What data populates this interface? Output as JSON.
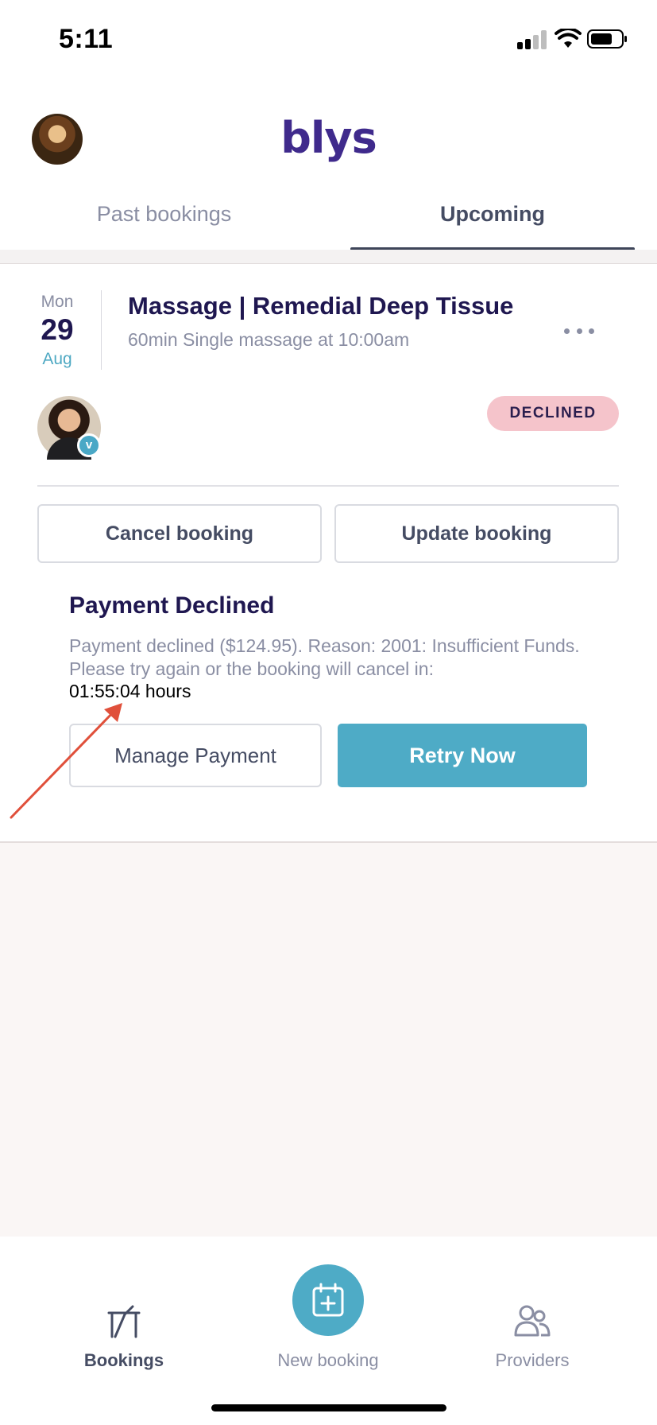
{
  "status_bar": {
    "time": "5:11"
  },
  "header": {
    "logo": "blys",
    "tabs": [
      {
        "label": "Past bookings",
        "active": false
      },
      {
        "label": "Upcoming",
        "active": true
      }
    ]
  },
  "booking": {
    "date": {
      "weekday": "Mon",
      "day": "29",
      "month": "Aug"
    },
    "title": "Massage | Remedial Deep Tissue",
    "subtitle": "60min Single massage at 10:00am",
    "status": "DECLINED",
    "status_color": "#f5c4cb",
    "therapist_verified_mark": "v",
    "actions": {
      "cancel_label": "Cancel booking",
      "update_label": "Update booking"
    },
    "payment": {
      "title": "Payment Declined",
      "message": "Payment declined ($124.95). Reason: 2001: Insufficient Funds. Please try again or the booking will cancel in:",
      "countdown": "01:55:04 hours",
      "manage_label": "Manage Payment",
      "retry_label": "Retry Now"
    }
  },
  "bottom_nav": {
    "items": [
      {
        "label": "Bookings",
        "icon": "bookings-icon",
        "active": true
      },
      {
        "label": "New booking",
        "icon": "calendar-plus-icon",
        "active": false
      },
      {
        "label": "Providers",
        "icon": "providers-icon",
        "active": false
      }
    ]
  },
  "colors": {
    "accent": "#4eabc6",
    "brand": "#3f2a8c",
    "annotation_arrow": "#e0503b"
  }
}
